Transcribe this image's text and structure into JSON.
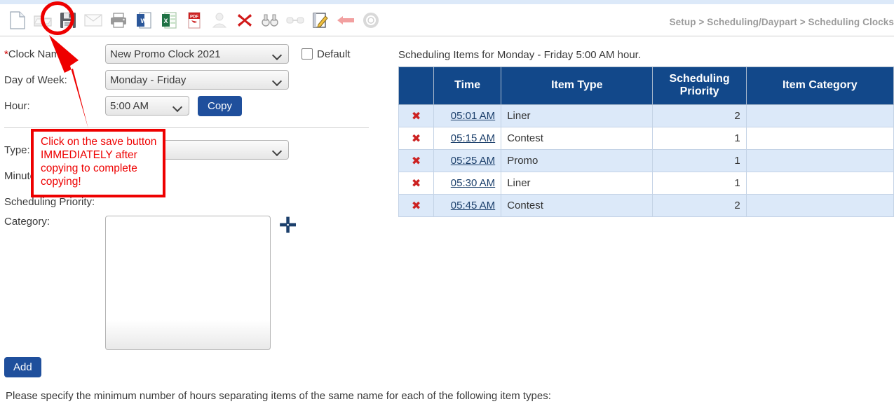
{
  "window": {
    "breadcrumb": "Setup > Scheduling/Daypart > Scheduling Clocks"
  },
  "toolbar": {
    "icons": [
      {
        "name": "new-document-icon",
        "label": "New"
      },
      {
        "name": "open-folder-icon",
        "label": "Open"
      },
      {
        "name": "save-icon",
        "label": "Save"
      },
      {
        "name": "email-icon",
        "label": "Email"
      },
      {
        "name": "print-icon",
        "label": "Print"
      },
      {
        "name": "export-word-icon",
        "label": "Export to Word"
      },
      {
        "name": "export-excel-icon",
        "label": "Export to Excel"
      },
      {
        "name": "export-pdf-icon",
        "label": "Export to PDF"
      },
      {
        "name": "user-icon",
        "label": "User"
      },
      {
        "name": "delete-icon",
        "label": "Delete"
      },
      {
        "name": "binoculars-icon",
        "label": "Find"
      },
      {
        "name": "link-icon",
        "label": "Link"
      },
      {
        "name": "edit-notepad-icon",
        "label": "Edit"
      },
      {
        "name": "back-arrow-icon",
        "label": "Back"
      },
      {
        "name": "settings-gear-icon",
        "label": "Settings"
      }
    ]
  },
  "form": {
    "clock_name_label": "*Clock Name:",
    "clock_name_required_marker": "*",
    "clock_name_value": "New Promo Clock 2021",
    "default_checkbox_label": "Default",
    "default_checked": false,
    "day_of_week_label": "Day of Week:",
    "day_of_week_value": "Monday - Friday",
    "hour_label": "Hour:",
    "hour_value": "5:00 AM",
    "copy_button_label": "Copy",
    "type_label": "Type:",
    "type_value": "",
    "minute_label": "Minute:",
    "minute_value": "",
    "scheduling_priority_label": "Scheduling Priority:",
    "category_label": "Category:",
    "category_value": "",
    "add_category_icon": "plus-icon",
    "add_button_label": "Add",
    "footer_note": "Please specify the minimum number of hours separating items of the same name for each of the following item types:"
  },
  "items_panel": {
    "title": "Scheduling Items for Monday - Friday 5:00 AM hour.",
    "columns": [
      "",
      "Time",
      "Item Type",
      "Scheduling Priority",
      "Item Category"
    ],
    "rows": [
      {
        "delete": "✖",
        "time": "05:01 AM",
        "item_type": "Liner",
        "priority": "2",
        "item_category": ""
      },
      {
        "delete": "✖",
        "time": "05:15 AM",
        "item_type": "Contest",
        "priority": "1",
        "item_category": ""
      },
      {
        "delete": "✖",
        "time": "05:25 AM",
        "item_type": "Promo",
        "priority": "1",
        "item_category": ""
      },
      {
        "delete": "✖",
        "time": "05:30 AM",
        "item_type": "Liner",
        "priority": "1",
        "item_category": ""
      },
      {
        "delete": "✖",
        "time": "05:45 AM",
        "item_type": "Contest",
        "priority": "2",
        "item_category": ""
      }
    ]
  },
  "annotation": {
    "callout_text": "Click on the save button IMMEDIATELY after copying to complete copying!",
    "highlight_color": "#ee0000",
    "target": "save-icon"
  },
  "colors": {
    "table_header": "#12488a",
    "table_row_alt": "#dce9f9",
    "button_blue": "#1f4f9c",
    "annotation_red": "#ee0000",
    "top_strip": "#dce9f9"
  }
}
